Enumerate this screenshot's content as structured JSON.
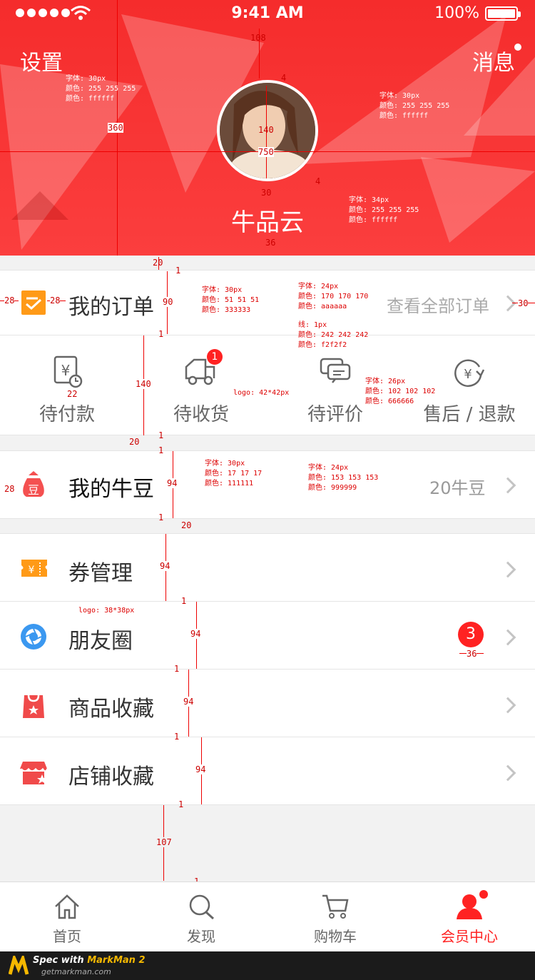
{
  "status_bar": {
    "time": "9:41 AM",
    "battery": "100%"
  },
  "header": {
    "settings_label": "设置",
    "messages_label": "消息",
    "username": "牛品云"
  },
  "orders": {
    "title": "我的订单",
    "view_all": "查看全部订单",
    "items": [
      {
        "label": "待付款",
        "icon": "pending-payment-icon"
      },
      {
        "label": "待收货",
        "icon": "delivery-truck-icon",
        "badge": "1"
      },
      {
        "label": "待评价",
        "icon": "comment-icon"
      },
      {
        "label": "售后 / 退款",
        "icon": "refund-icon"
      }
    ]
  },
  "beans": {
    "title": "我的牛豆",
    "value": "20牛豆"
  },
  "menu": [
    {
      "label": "券管理",
      "icon": "coupon-icon"
    },
    {
      "label": "朋友圈",
      "icon": "moments-icon",
      "badge": "3"
    },
    {
      "label": "商品收藏",
      "icon": "product-favorite-icon"
    },
    {
      "label": "店铺收藏",
      "icon": "shop-favorite-icon"
    }
  ],
  "tabbar": [
    {
      "label": "首页",
      "icon": "home-icon",
      "active": false
    },
    {
      "label": "发现",
      "icon": "search-icon",
      "active": false
    },
    {
      "label": "购物车",
      "icon": "cart-icon",
      "active": false
    },
    {
      "label": "会员中心",
      "icon": "user-icon",
      "active": true
    }
  ],
  "colors": {
    "brand_red": "#f42d2d",
    "text_dark": "#333333",
    "text_gray": "#aaaaaa",
    "divider": "#f2f2f2"
  },
  "specs": {
    "s1": "字体: 30px\n颜色: 255 255 255\n颜色: ffffff",
    "s2": "字体: 30px\n颜色: 255 255 255\n颜色: ffffff",
    "s3": "字体: 34px\n颜色: 255 255 255\n颜色: ffffff",
    "s4": "字体: 30px\n颜色: 51 51 51\n颜色: 333333",
    "s5": "字体: 24px\n颜色: 170 170 170\n颜色: aaaaaa",
    "s6": "线: 1px\n颜色: 242 242 242\n颜色: f2f2f2",
    "s7": "字体: 26px\n颜色: 102 102 102\n颜色: 666666",
    "s8": "logo: 42*42px",
    "s9": "字体: 30px\n颜色: 17 17 17\n颜色: 111111",
    "s10": "字体: 24px\n颜色: 153 153 153\n颜色: 999999",
    "s11": "logo: 38*38px",
    "m108": "108",
    "m4a": "4",
    "m140": "140",
    "m750": "750",
    "m360": "360",
    "m4b": "4",
    "m30": "30",
    "m36a": "36",
    "m20a": "20",
    "m1a": "1",
    "m28a": "28",
    "m28b": "28",
    "m90": "90",
    "m30b": "30",
    "m1b": "1",
    "m22": "22",
    "m140b": "140",
    "m20b": "20",
    "m1c": "1",
    "m1d": "1",
    "m28c": "28",
    "m94a": "94",
    "m1e": "1",
    "m20c": "20",
    "m94b": "94",
    "m1f": "1",
    "m94c": "94",
    "m36b": "36",
    "m1g": "1",
    "m94d": "94",
    "m1h": "1",
    "m94e": "94",
    "m1i": "1",
    "m107": "107",
    "m1j": "1"
  },
  "watermark": {
    "line1": "Spec with",
    "brand": "MarkMan 2",
    "line2": "getmarkman.com"
  }
}
